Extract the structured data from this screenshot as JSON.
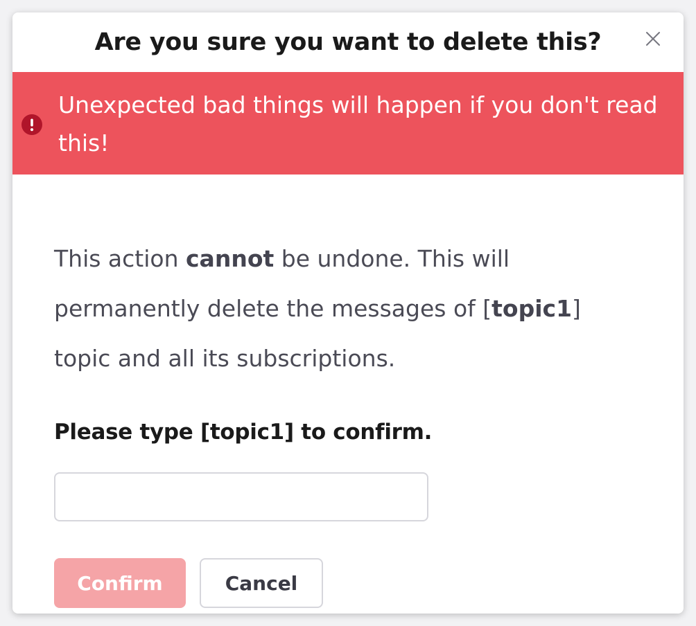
{
  "dialog": {
    "title": "Are you sure you want to delete this?",
    "close_icon": "close-icon"
  },
  "alert": {
    "icon": "exclamation-circle-icon",
    "text": "Unexpected bad things will happen if you don't read this!",
    "background_color": "#ed535c",
    "icon_color": "#b0152a"
  },
  "body": {
    "part1": "This action ",
    "emphasis": "cannot",
    "part2": " be undone. This will permanently delete the messages of [",
    "topic": "topic1",
    "part3": "] topic and all its subscriptions."
  },
  "confirm_field": {
    "label": "Please type [topic1] to confirm.",
    "value": "",
    "placeholder": ""
  },
  "buttons": {
    "confirm_label": "Confirm",
    "cancel_label": "Cancel",
    "confirm_color": "#f5a4a7"
  }
}
